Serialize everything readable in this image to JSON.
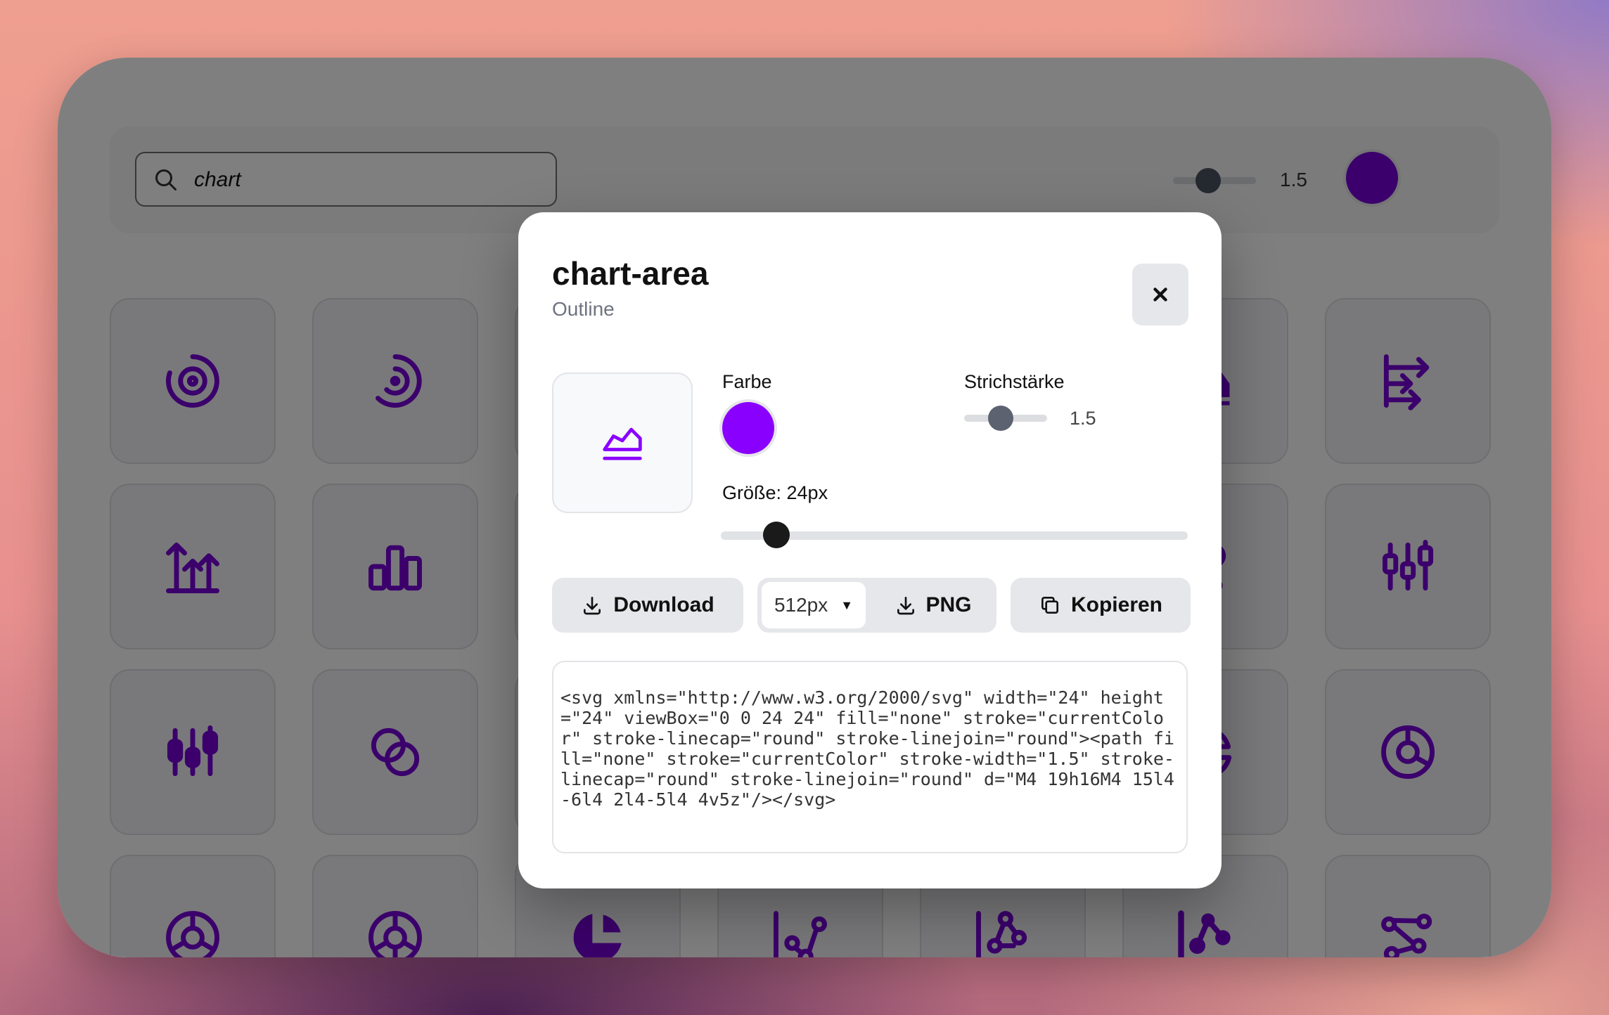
{
  "toolbar": {
    "search_value": "chart",
    "stroke_value": "1.5",
    "color": "#7600d6"
  },
  "icon_color": "#7600d6",
  "grid_icons": [
    [
      "chart-donut-icon",
      "chart-arcs-icon",
      "",
      "",
      "",
      "chart-area-filled-icon",
      "chart-arrows-icon"
    ],
    [
      "chart-arrows-vertical-icon",
      "chart-bar-icon",
      "",
      "",
      "",
      "chart-bubble-filled-icon",
      "chart-candle-icon"
    ],
    [
      "chart-candle-filled-icon",
      "chart-circles-icon",
      "",
      "",
      "",
      "chart-pie-icon",
      "chart-donut-2-icon"
    ],
    [
      "chart-donut-3-icon",
      "chart-donut-4-icon",
      "chart-pie-filled-icon",
      "chart-dots-icon",
      "chart-dots-2-icon",
      "chart-dots-filled-icon",
      "chart-dots-3-icon"
    ]
  ],
  "modal": {
    "title": "chart-area",
    "subtitle": "Outline",
    "color_label": "Farbe",
    "color": "#8a00ff",
    "stroke_label": "Strichstärke",
    "stroke_value": "1.5",
    "stroke_fraction": 0.5,
    "size_label": "Größe: 24px",
    "size_fraction": 0.1,
    "download_label": "Download",
    "px_option": "512px",
    "png_label": "PNG",
    "copy_label": "Kopieren",
    "code": "<svg xmlns=\"http://www.w3.org/2000/svg\" width=\"24\" height=\"24\" viewBox=\"0 0 24 24\" fill=\"none\" stroke=\"currentColor\" stroke-linecap=\"round\" stroke-linejoin=\"round\"><path fill=\"none\" stroke=\"currentColor\" stroke-width=\"1.5\" stroke-linecap=\"round\" stroke-linejoin=\"round\" d=\"M4 19h16M4 15l4-6l4 2l4-5l4 4v5z\"/></svg>"
  }
}
